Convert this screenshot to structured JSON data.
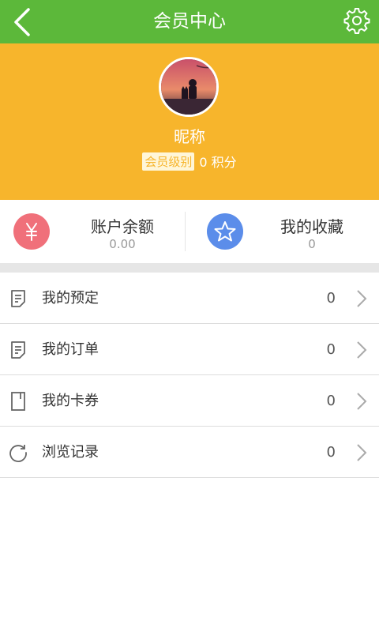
{
  "header": {
    "title": "会员中心",
    "back_icon": "chevron-left-icon",
    "settings_icon": "gear-icon",
    "color": "#5cb83a"
  },
  "profile": {
    "nickname": "昵称",
    "level_label": "会员级别",
    "points_text": "0 积分",
    "background": "#f7b52c"
  },
  "stats": [
    {
      "label": "账户余额",
      "value": "0.00",
      "icon": "yen-icon",
      "color": "#f0707a"
    },
    {
      "label": "我的收藏",
      "value": "0",
      "icon": "star-icon",
      "color": "#5b8dea"
    }
  ],
  "menu": [
    {
      "label": "我的预定",
      "count": "0",
      "icon": "document-icon"
    },
    {
      "label": "我的订单",
      "count": "0",
      "icon": "order-icon"
    },
    {
      "label": "我的卡券",
      "count": "0",
      "icon": "card-icon"
    },
    {
      "label": "浏览记录",
      "count": "0",
      "icon": "refresh-icon"
    }
  ]
}
